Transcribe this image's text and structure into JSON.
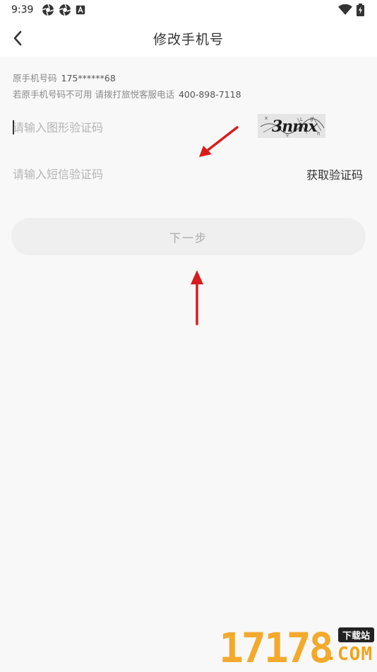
{
  "status_bar": {
    "time": "9:39",
    "icons": [
      "aperture-icon",
      "aperture-icon",
      "a-box-icon"
    ],
    "right_icons": [
      "wifi-icon",
      "battery-charging-icon"
    ]
  },
  "header": {
    "title": "修改手机号",
    "back_icon": "chevron-left-icon"
  },
  "info": {
    "original_label": "原手机号码",
    "original_number": "175******68",
    "help_text": "若原手机号码不可用 请拨打旅悦客服电话",
    "help_phone": "400-898-7118"
  },
  "form": {
    "captcha_placeholder": "请输入图形验证码",
    "captcha_image_text": "3nmx",
    "sms_placeholder": "请输入短信验证码",
    "sms_button": "获取验证码",
    "next_button": "下一步"
  },
  "watermark": {
    "brand_number": "17178",
    "badge": "下载站",
    "suffix": ".COM"
  },
  "colors": {
    "arrow": "#d81c1c",
    "background": "#f8f8f8",
    "button_bg": "#efefef",
    "button_text": "#a9a9a9",
    "watermark_orange": "#f3a31b"
  }
}
